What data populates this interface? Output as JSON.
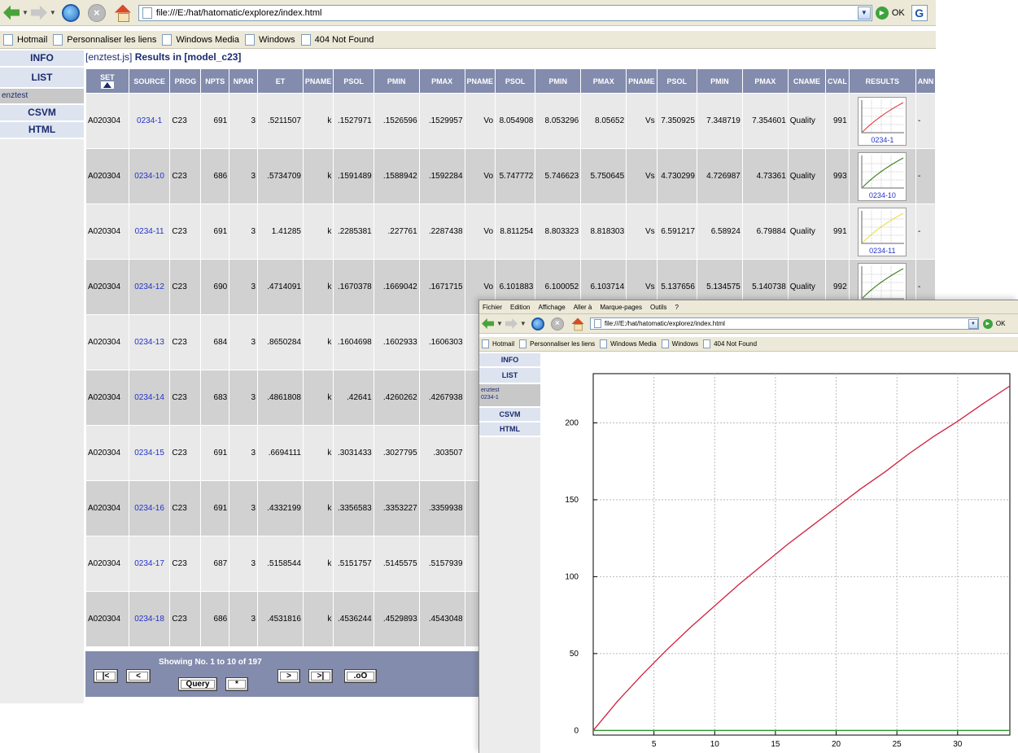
{
  "window1": {
    "address": "file:///E:/hat/hatomatic/explorez/index.html",
    "go_label": "OK",
    "google_letter": "G",
    "bookmarks": [
      "Hotmail",
      "Personnaliser les liens",
      "Windows Media",
      "Windows",
      "404 Not Found"
    ],
    "sidebar": {
      "items": [
        "INFO",
        "LIST",
        "enztest",
        "CSVM",
        "HTML"
      ]
    },
    "heading": {
      "prefix": "[enztest.js]",
      "text": "Results in",
      "model": "[model_c23]"
    },
    "columns": [
      "SET",
      "SOURCE",
      "PROG",
      "NPTS",
      "NPAR",
      "ET",
      "PNAME",
      "PSOL",
      "PMIN",
      "PMAX",
      "PNAME",
      "PSOL",
      "PMIN",
      "PMAX",
      "PNAME",
      "PSOL",
      "PMIN",
      "PMAX",
      "CNAME",
      "CVAL",
      "RESULTS",
      "ANN"
    ],
    "rows": [
      [
        "A020304",
        "0234-1",
        "C23",
        "691",
        "3",
        ".5211507",
        "k",
        ".1527971",
        ".1526596",
        ".1529957",
        "Vo",
        "8.054908",
        "8.053296",
        "8.05652",
        "Vs",
        "7.350925",
        "7.348719",
        "7.354601",
        "Quality",
        "991",
        "0234-1",
        "-"
      ],
      [
        "A020304",
        "0234-10",
        "C23",
        "686",
        "3",
        ".5734709",
        "k",
        ".1591489",
        ".1588942",
        ".1592284",
        "Vo",
        "5.747772",
        "5.746623",
        "5.750645",
        "Vs",
        "4.730299",
        "4.726987",
        "4.73361",
        "Quality",
        "993",
        "0234-10",
        "-"
      ],
      [
        "A020304",
        "0234-11",
        "C23",
        "691",
        "3",
        "1.41285",
        "k",
        ".2285381",
        ".227761",
        ".2287438",
        "Vo",
        "8.811254",
        "8.803323",
        "8.818303",
        "Vs",
        "6.591217",
        "6.58924",
        "6.79884",
        "Quality",
        "991",
        "0234-11",
        "-"
      ],
      [
        "A020304",
        "0234-12",
        "C23",
        "690",
        "3",
        ".4714091",
        "k",
        ".1670378",
        ".1669042",
        ".1671715",
        "Vo",
        "6.101883",
        "6.100052",
        "6.103714",
        "Vs",
        "5.137656",
        "5.134575",
        "5.140738",
        "Quality",
        "992",
        "0234-12",
        "-"
      ],
      [
        "A020304",
        "0234-13",
        "C23",
        "684",
        "3",
        ".8650284",
        "k",
        ".1604698",
        ".1602933",
        ".1606303",
        "",
        "",
        "",
        "",
        "",
        "",
        "",
        "",
        "",
        "",
        "",
        ""
      ],
      [
        "A020304",
        "0234-14",
        "C23",
        "683",
        "3",
        ".4861808",
        "k",
        ".42641",
        ".4260262",
        ".4267938",
        "",
        "",
        "",
        "",
        "",
        "",
        "",
        "",
        "",
        "",
        "",
        ""
      ],
      [
        "A020304",
        "0234-15",
        "C23",
        "691",
        "3",
        ".6694111",
        "k",
        ".3031433",
        ".3027795",
        ".303507",
        "",
        "",
        "",
        "",
        "",
        "",
        "",
        "",
        "",
        "",
        "",
        ""
      ],
      [
        "A020304",
        "0234-16",
        "C23",
        "691",
        "3",
        ".4332199",
        "k",
        ".3356583",
        ".3353227",
        ".3359938",
        "",
        "",
        "",
        "",
        "",
        "",
        "",
        "",
        "",
        "",
        "",
        ""
      ],
      [
        "A020304",
        "0234-17",
        "C23",
        "687",
        "3",
        ".5158544",
        "k",
        ".5151757",
        ".5145575",
        ".5157939",
        "",
        "",
        "",
        "",
        "",
        "",
        "",
        "",
        "",
        "",
        "",
        ""
      ],
      [
        "A020304",
        "0234-18",
        "C23",
        "686",
        "3",
        ".4531816",
        "k",
        ".4536244",
        ".4529893",
        ".4543048",
        "",
        "",
        "",
        "",
        "",
        "",
        "",
        "",
        "",
        "",
        "",
        ""
      ]
    ],
    "thumb_colors": [
      "#e03030",
      "#3b7a1a",
      "#e8e040",
      "#3b7a1a"
    ],
    "pager": {
      "showing": "Showing No. 1 to 10 of 197",
      "first": "|<",
      "prev": "<",
      "query": "Query",
      "star": "*",
      "next": ">",
      "last": ">|",
      "oo": ".oO"
    }
  },
  "window2": {
    "menu": [
      "Fichier",
      "Edition",
      "Affichage",
      "Aller à",
      "Marque-pages",
      "Outils",
      "?"
    ],
    "address": "file:///E:/hat/hatomatic/explorez/index.html",
    "go_label": "OK",
    "bookmarks": [
      "Hotmail",
      "Personnaliser les liens",
      "Windows Media",
      "Windows",
      "404 Not Found"
    ],
    "sidebar": {
      "items": [
        "INFO",
        "LIST",
        "CSVM",
        "HTML"
      ],
      "selected_line1": "enztest",
      "selected_line2": "0234-1"
    }
  },
  "chart_data": {
    "type": "line",
    "title": "",
    "xlabel": "",
    "ylabel": "",
    "xlim": [
      0,
      34.3
    ],
    "ylim": [
      -3,
      232
    ],
    "xticks": [
      5,
      10,
      15,
      20,
      25,
      30
    ],
    "yticks": [
      0,
      50,
      100,
      150,
      200
    ],
    "grid": true,
    "series": [
      {
        "color": "#d02040",
        "x": [
          0,
          2,
          4,
          6,
          8,
          10,
          12,
          14,
          16,
          18,
          20,
          22,
          24,
          26,
          28,
          30,
          32,
          34.3
        ],
        "y": [
          0,
          19,
          36,
          52,
          67,
          81,
          95,
          108,
          121,
          133,
          145,
          157,
          168,
          180,
          191,
          201,
          212,
          224
        ]
      },
      {
        "color": "#2a9a2a",
        "x": [
          0,
          34.3
        ],
        "y": [
          0,
          0
        ]
      }
    ]
  }
}
